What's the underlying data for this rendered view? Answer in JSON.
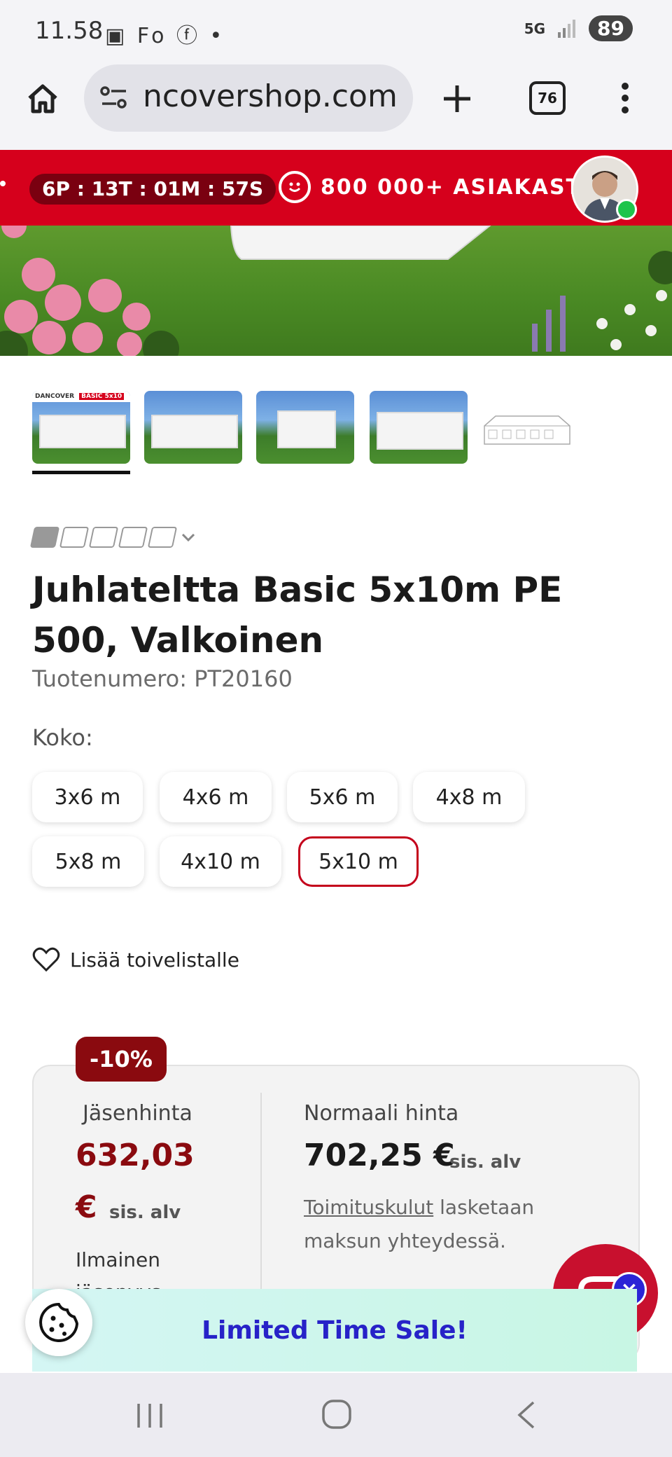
{
  "status_bar": {
    "time": "11.58",
    "left_icons": "▣ Fo ⓕ •",
    "network": "5G",
    "battery": "89"
  },
  "browser": {
    "url": "ncovershop.com",
    "tab_count": "76"
  },
  "promo_bar": {
    "timer": "6P : 13T : 01M : 57S",
    "customers": "800 000+ ASIAKAST"
  },
  "product": {
    "title": "Juhlateltta Basic 5x10m PE 500, Valkoinen",
    "sku": "Tuotenumero: PT20160",
    "size_label": "Koko:",
    "sizes": [
      "3x6 m",
      "4x6 m",
      "5x6 m",
      "4x8 m",
      "5x8 m",
      "4x10 m",
      "5x10 m"
    ],
    "selected_size": "5x10 m",
    "wishlist": "Lisää toivelistalle"
  },
  "thumbnail_brand": "DANCOVER",
  "thumbnail_label": "BASIC 5x10",
  "pricing": {
    "discount": "-10%",
    "member_label": "Jäsenhinta",
    "member_price": "632,03",
    "member_euro": "€",
    "member_vat": "sis. alv",
    "member_note": "Ilmainen jäsenyys",
    "normal_label": "Normaali hinta",
    "normal_price": "702,25 €",
    "normal_vat": "sis. alv",
    "shipping_link": "Toimituskulut",
    "shipping_text": " lasketaan maksun yhteydessä."
  },
  "banner": {
    "text": "Limited Time Sale!"
  },
  "colors": {
    "brand_red": "#d6001c",
    "price_red": "#8a0a0f",
    "banner_text": "#2722c8"
  }
}
